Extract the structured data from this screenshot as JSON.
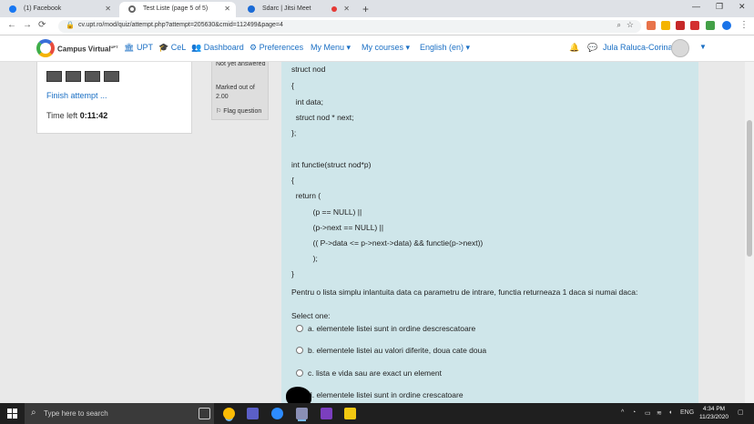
{
  "browser": {
    "tabs": [
      {
        "title": "(1) Facebook",
        "icon_color": "#1877f2"
      },
      {
        "title": "Test Liste (page 5 of 5)",
        "icon_color": "#d0d0d0"
      },
      {
        "title": "Sdarc | Jitsi Meet",
        "icon_color": "#1b6bd6"
      }
    ],
    "new_tab": "+",
    "url": "cv.upt.ro/mod/quiz/attempt.php?attempt=205630&cmid=112499&page=4",
    "window_controls": [
      "—",
      "❐",
      "✕"
    ]
  },
  "navbar": {
    "brand": "Campus Virtual",
    "brand_sup": "UPT",
    "links": [
      {
        "icon": "🏛",
        "label": "UPT"
      },
      {
        "icon": "🎓",
        "label": "CeL"
      },
      {
        "icon": "👥",
        "label": "Dashboard"
      },
      {
        "icon": "⚙",
        "label": "Preferences"
      },
      {
        "icon": "",
        "label": "My Menu ▾"
      },
      {
        "icon": "",
        "label": "My courses ▾"
      },
      {
        "icon": "",
        "label": "English (en) ▾"
      }
    ],
    "user_name": "Jula Raluca-Corina"
  },
  "quiz_nav": {
    "finish_label": "Finish attempt ...",
    "time_left_label": "Time left",
    "time_left_value": "0:11:42"
  },
  "question_info": {
    "state": "Not yet answered",
    "grade": "Marked out of 2.00",
    "flag_label": "Flag question"
  },
  "question": {
    "code_lines": [
      "struct nod",
      "{",
      "  int data;",
      "  struct nod * next;",
      "};",
      "",
      "int functie(struct nod*p)",
      "{",
      "  return (",
      "          (p == NULL) ||",
      "          (p->next == NULL) ||",
      "          (( P->data <= p->next->data) && functie(p->next))",
      "          );",
      "}"
    ],
    "prompt": "Pentru o lista simplu inlantuita data ca parametru de intrare, functia returneaza 1 daca si numai daca:",
    "select_one": "Select one:",
    "options": [
      "a. elementele listei sunt in ordine descrescatoare",
      "b. elementele listei au valori diferite, doua cate doua",
      "c. lista e vida sau are exact un element",
      "d. elementele listei sunt in ordine crescatoare"
    ]
  },
  "taskbar": {
    "search_placeholder": "Type here to search",
    "language": "ENG",
    "time": "4:34 PM",
    "date": "11/23/2020"
  }
}
